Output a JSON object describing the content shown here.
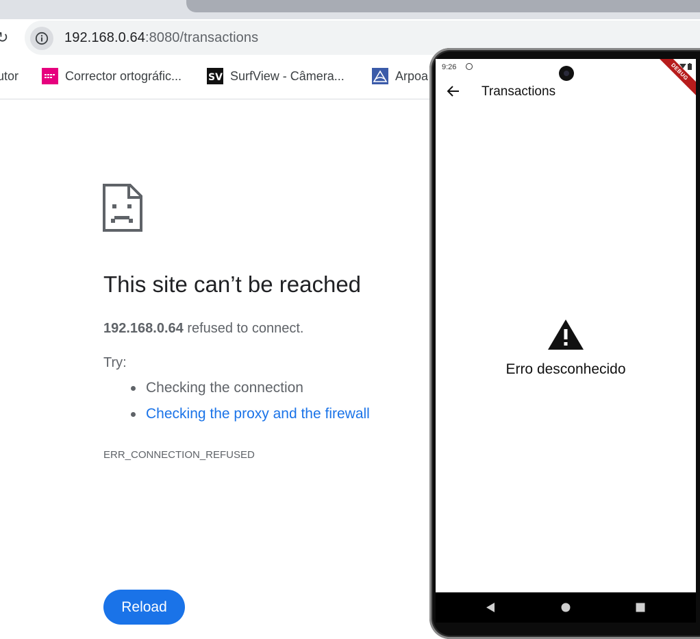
{
  "browser": {
    "url_host": "192.168.0.64",
    "url_rest": ":8080/transactions",
    "reload_icon": "reload-icon",
    "info_icon": "info-icon"
  },
  "bookmarks": [
    {
      "label": "utor",
      "icon": "bookmark-favicon"
    },
    {
      "label": "Corrector ortográfic...",
      "icon": "corrector-favicon",
      "color": "#e6007e"
    },
    {
      "label": "SurfView - Câmera...",
      "icon": "surfview-favicon",
      "color": "#111111"
    },
    {
      "label": "Arpoa",
      "icon": "arpoador-favicon",
      "color": "#3b5ba9"
    }
  ],
  "error_page": {
    "icon": "sad-page-icon",
    "title": "This site can’t be reached",
    "host": "192.168.0.64",
    "message": " refused to connect.",
    "try_label": "Try:",
    "suggestions": [
      "Checking the connection",
      "Checking the proxy and the firewall"
    ],
    "error_code": "ERR_CONNECTION_REFUSED",
    "reload_label": "Reload",
    "link_color": "#1a73e8"
  },
  "phone": {
    "status_time": "9:26",
    "debug_banner": "DEBUG",
    "appbar_title": "Transactions",
    "warning_icon": "warning-icon",
    "error_message": "Erro desconhecido",
    "nav": [
      "back-triangle-icon",
      "home-circle-icon",
      "recents-square-icon"
    ]
  }
}
